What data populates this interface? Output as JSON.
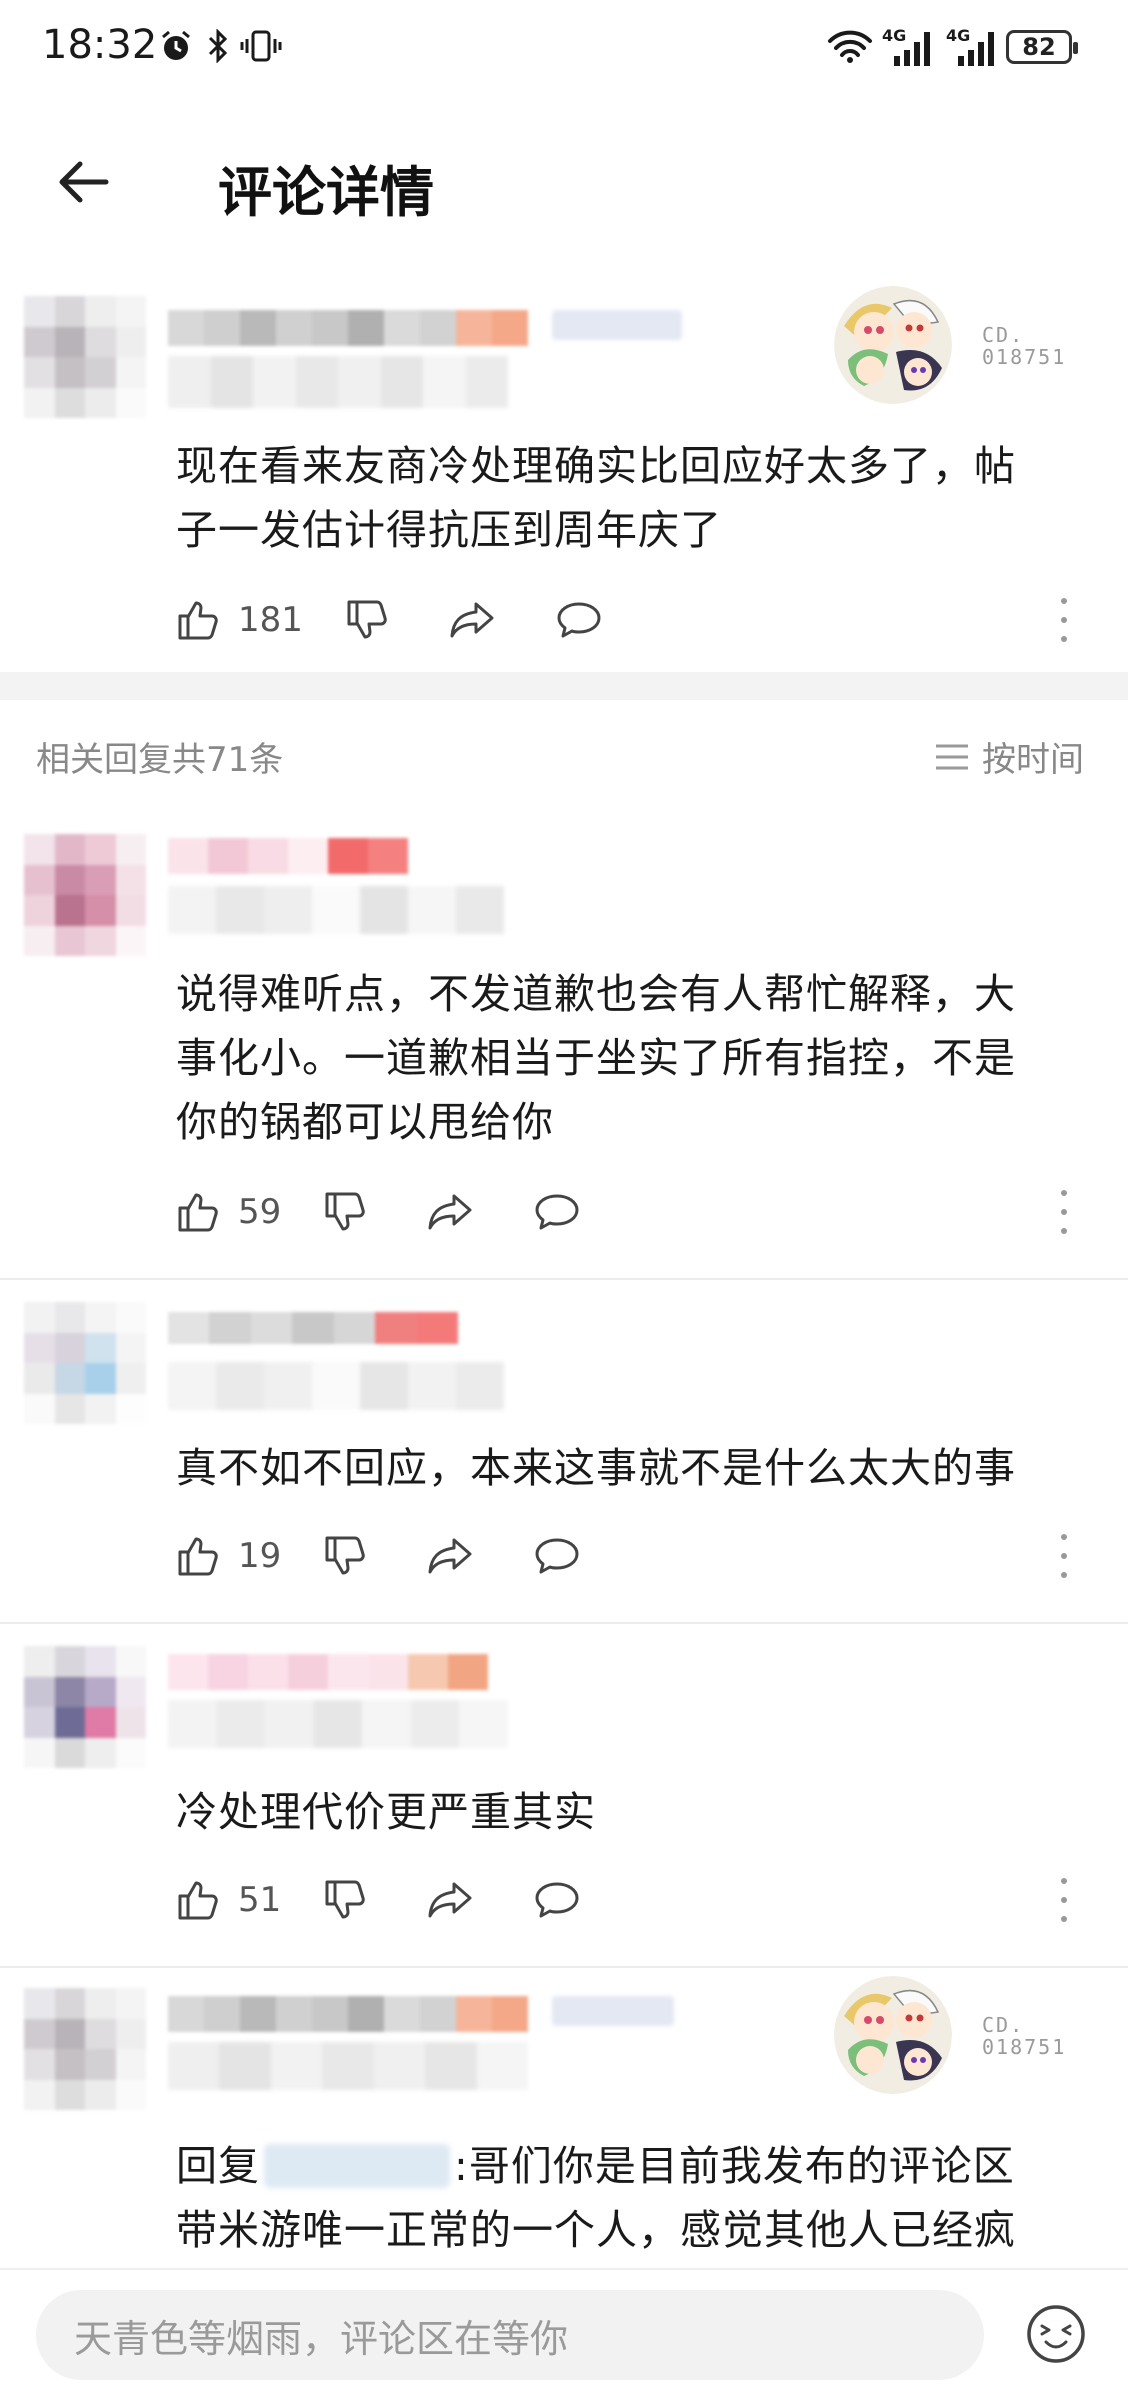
{
  "status_bar": {
    "time": "18:32",
    "network_1": "4G",
    "network_2": "4G",
    "battery": "82"
  },
  "header": {
    "title": "评论详情"
  },
  "main_comment": {
    "badge_code_line1": "CD.",
    "badge_code_line2": "018751",
    "text_line1": "现在看来友商冷处理确实比回应好太多了，帖",
    "text_line2": "子一发估计得抗压到周年庆了",
    "likes": "181"
  },
  "replies_header": {
    "label": "相关回复共71条",
    "sort_label": "按时间"
  },
  "replies": [
    {
      "text_line1": "说得难听点，不发道歉也会有人帮忙解释，大",
      "text_line2": "事化小。一道歉相当于坐实了所有指控，不是",
      "text_line3": "你的锅都可以甩给你",
      "likes": "59"
    },
    {
      "text_line1": "真不如不回应，本来这事就不是什么太大的事",
      "likes": "19"
    },
    {
      "text_line1": "冷处理代价更严重其实",
      "likes": "51"
    },
    {
      "badge_code_line1": "CD.",
      "badge_code_line2": "018751",
      "reply_prefix": "回复",
      "text_line1_rest": ":哥们你是目前我发布的评论区",
      "text_line2": "带米游唯一正常的一个人，感觉其他人已经疯"
    }
  ],
  "bottom_bar": {
    "placeholder": "天青色等烟雨，评论区在等你"
  },
  "colors": {
    "accent_red": "#f05a5a",
    "divider": "#f3f3f3",
    "muted_text": "#888888"
  }
}
